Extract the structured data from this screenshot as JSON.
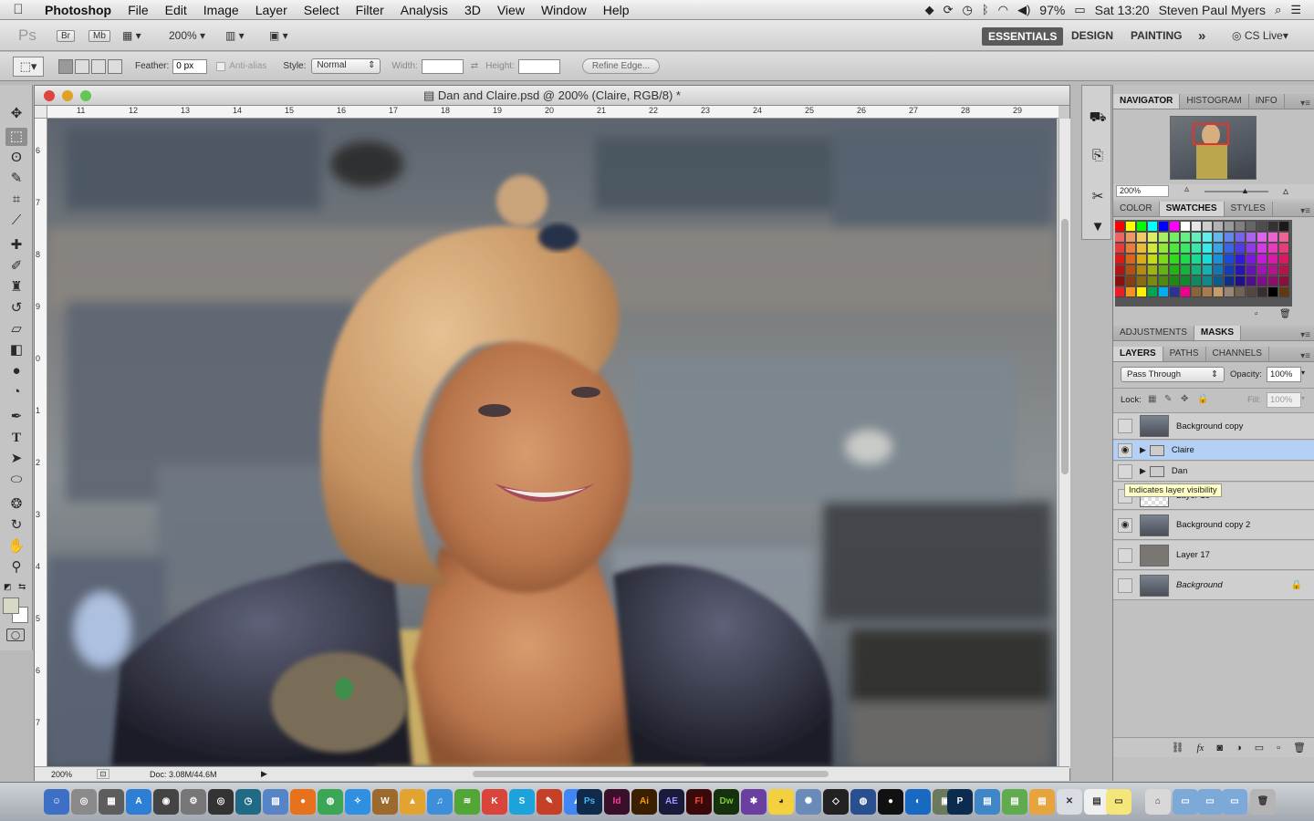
{
  "menubar": {
    "app_name": "Photoshop",
    "items": [
      "File",
      "Edit",
      "Image",
      "Layer",
      "Select",
      "Filter",
      "Analysis",
      "3D",
      "View",
      "Window",
      "Help"
    ],
    "battery": "97%",
    "clock": "Sat 13:20",
    "user": "Steven Paul Myers"
  },
  "appbar": {
    "ps_label": "Ps",
    "br_label": "Br",
    "mb_label": "Mb",
    "zoom": "200%",
    "workspaces": [
      "ESSENTIALS",
      "DESIGN",
      "PAINTING"
    ],
    "more": "»",
    "cslive": "CS Live"
  },
  "options": {
    "feather_label": "Feather:",
    "feather_value": "0 px",
    "antialias_label": "Anti-alias",
    "style_label": "Style:",
    "style_value": "Normal",
    "width_label": "Width:",
    "height_label": "Height:",
    "refine_label": "Refine Edge..."
  },
  "document": {
    "title": "Dan and Claire.psd @ 200% (Claire, RGB/8) *",
    "ruler_top": [
      "11",
      "12",
      "13",
      "14",
      "15",
      "16",
      "17",
      "18",
      "19",
      "20",
      "21",
      "22",
      "23",
      "24",
      "25",
      "26",
      "27",
      "28",
      "29"
    ],
    "ruler_left": [
      "6",
      "7",
      "8",
      "9",
      "0",
      "1",
      "2",
      "3",
      "4",
      "5",
      "6",
      "7"
    ],
    "status_zoom": "200%",
    "status_doc": "Doc: 3.08M/44.6M"
  },
  "navigator": {
    "tabs": [
      "NAVIGATOR",
      "HISTOGRAM",
      "INFO"
    ],
    "zoom": "200%"
  },
  "color_panel": {
    "tabs": [
      "COLOR",
      "SWATCHES",
      "STYLES"
    ],
    "swatch_colors_row1": [
      "#ff0000",
      "#ffff00",
      "#00ff00",
      "#00ffff",
      "#0000ff",
      "#ff00ff",
      "#ffffff",
      "#e6e6e6",
      "#cccccc",
      "#b3b3b3",
      "#999999",
      "#808080",
      "#666666",
      "#4d4d4d",
      "#333333",
      "#1a1a1a"
    ],
    "swatch_colors_row2": [
      "#ed1c24",
      "#f7941d",
      "#fff200",
      "#00a651",
      "#00aeef",
      "#2e3192",
      "#ec008c",
      "#8c6239",
      "#a67c52",
      "#c69c6d",
      "#998675",
      "#736357",
      "#534741",
      "#362f2d",
      "#000000",
      "#603913"
    ]
  },
  "adjustments": {
    "tabs": [
      "ADJUSTMENTS",
      "MASKS"
    ]
  },
  "layers_panel": {
    "tabs": [
      "LAYERS",
      "PATHS",
      "CHANNELS"
    ],
    "blend_mode": "Pass Through",
    "opacity_label": "Opacity:",
    "opacity_value": "100%",
    "lock_label": "Lock:",
    "fill_label": "Fill:",
    "fill_value": "100%",
    "tooltip": "Indicates layer visibility",
    "layers": [
      {
        "name": "Background copy",
        "visible": false
      },
      {
        "name": "Claire",
        "visible": true
      },
      {
        "name": "Dan",
        "visible": false
      },
      {
        "name": "Layer 18",
        "visible": false
      },
      {
        "name": "Background copy 2",
        "visible": true
      },
      {
        "name": "Layer 17",
        "visible": false
      },
      {
        "name": "Background",
        "visible": false
      }
    ]
  },
  "dock": {
    "labels": [
      "Ps",
      "Id",
      "Ai",
      "AE",
      "Fl",
      "Dw"
    ]
  }
}
